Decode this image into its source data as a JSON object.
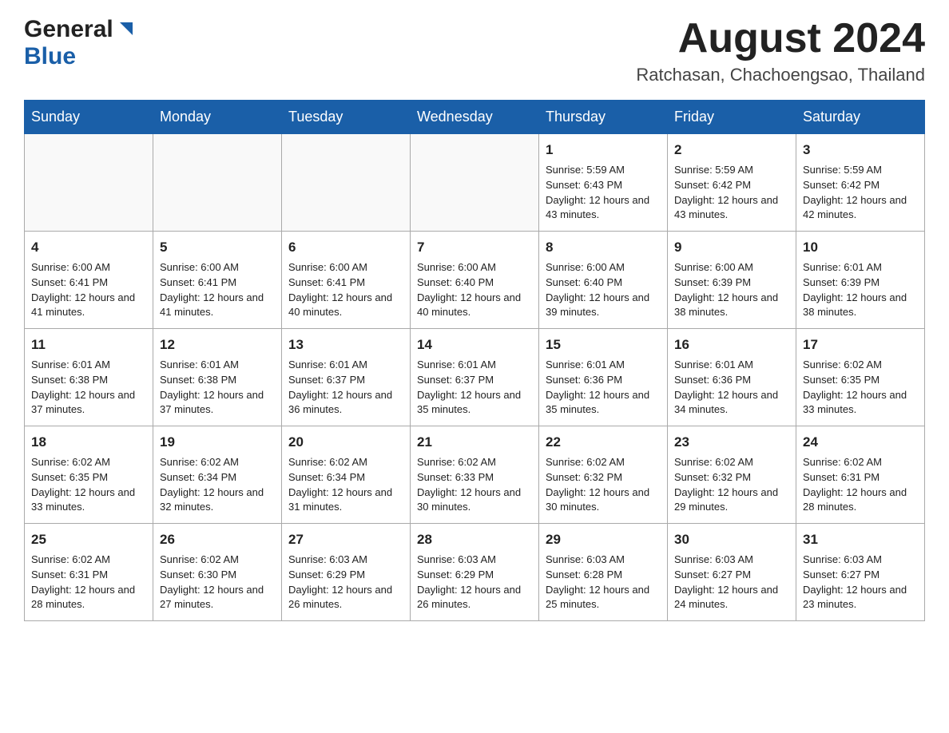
{
  "header": {
    "logo_general": "General",
    "logo_blue": "Blue",
    "month_title": "August 2024",
    "location": "Ratchasan, Chachoengsao, Thailand"
  },
  "weekdays": [
    "Sunday",
    "Monday",
    "Tuesday",
    "Wednesday",
    "Thursday",
    "Friday",
    "Saturday"
  ],
  "weeks": [
    [
      {
        "day": "",
        "sunrise": "",
        "sunset": "",
        "daylight": ""
      },
      {
        "day": "",
        "sunrise": "",
        "sunset": "",
        "daylight": ""
      },
      {
        "day": "",
        "sunrise": "",
        "sunset": "",
        "daylight": ""
      },
      {
        "day": "",
        "sunrise": "",
        "sunset": "",
        "daylight": ""
      },
      {
        "day": "1",
        "sunrise": "Sunrise: 5:59 AM",
        "sunset": "Sunset: 6:43 PM",
        "daylight": "Daylight: 12 hours and 43 minutes."
      },
      {
        "day": "2",
        "sunrise": "Sunrise: 5:59 AM",
        "sunset": "Sunset: 6:42 PM",
        "daylight": "Daylight: 12 hours and 43 minutes."
      },
      {
        "day": "3",
        "sunrise": "Sunrise: 5:59 AM",
        "sunset": "Sunset: 6:42 PM",
        "daylight": "Daylight: 12 hours and 42 minutes."
      }
    ],
    [
      {
        "day": "4",
        "sunrise": "Sunrise: 6:00 AM",
        "sunset": "Sunset: 6:41 PM",
        "daylight": "Daylight: 12 hours and 41 minutes."
      },
      {
        "day": "5",
        "sunrise": "Sunrise: 6:00 AM",
        "sunset": "Sunset: 6:41 PM",
        "daylight": "Daylight: 12 hours and 41 minutes."
      },
      {
        "day": "6",
        "sunrise": "Sunrise: 6:00 AM",
        "sunset": "Sunset: 6:41 PM",
        "daylight": "Daylight: 12 hours and 40 minutes."
      },
      {
        "day": "7",
        "sunrise": "Sunrise: 6:00 AM",
        "sunset": "Sunset: 6:40 PM",
        "daylight": "Daylight: 12 hours and 40 minutes."
      },
      {
        "day": "8",
        "sunrise": "Sunrise: 6:00 AM",
        "sunset": "Sunset: 6:40 PM",
        "daylight": "Daylight: 12 hours and 39 minutes."
      },
      {
        "day": "9",
        "sunrise": "Sunrise: 6:00 AM",
        "sunset": "Sunset: 6:39 PM",
        "daylight": "Daylight: 12 hours and 38 minutes."
      },
      {
        "day": "10",
        "sunrise": "Sunrise: 6:01 AM",
        "sunset": "Sunset: 6:39 PM",
        "daylight": "Daylight: 12 hours and 38 minutes."
      }
    ],
    [
      {
        "day": "11",
        "sunrise": "Sunrise: 6:01 AM",
        "sunset": "Sunset: 6:38 PM",
        "daylight": "Daylight: 12 hours and 37 minutes."
      },
      {
        "day": "12",
        "sunrise": "Sunrise: 6:01 AM",
        "sunset": "Sunset: 6:38 PM",
        "daylight": "Daylight: 12 hours and 37 minutes."
      },
      {
        "day": "13",
        "sunrise": "Sunrise: 6:01 AM",
        "sunset": "Sunset: 6:37 PM",
        "daylight": "Daylight: 12 hours and 36 minutes."
      },
      {
        "day": "14",
        "sunrise": "Sunrise: 6:01 AM",
        "sunset": "Sunset: 6:37 PM",
        "daylight": "Daylight: 12 hours and 35 minutes."
      },
      {
        "day": "15",
        "sunrise": "Sunrise: 6:01 AM",
        "sunset": "Sunset: 6:36 PM",
        "daylight": "Daylight: 12 hours and 35 minutes."
      },
      {
        "day": "16",
        "sunrise": "Sunrise: 6:01 AM",
        "sunset": "Sunset: 6:36 PM",
        "daylight": "Daylight: 12 hours and 34 minutes."
      },
      {
        "day": "17",
        "sunrise": "Sunrise: 6:02 AM",
        "sunset": "Sunset: 6:35 PM",
        "daylight": "Daylight: 12 hours and 33 minutes."
      }
    ],
    [
      {
        "day": "18",
        "sunrise": "Sunrise: 6:02 AM",
        "sunset": "Sunset: 6:35 PM",
        "daylight": "Daylight: 12 hours and 33 minutes."
      },
      {
        "day": "19",
        "sunrise": "Sunrise: 6:02 AM",
        "sunset": "Sunset: 6:34 PM",
        "daylight": "Daylight: 12 hours and 32 minutes."
      },
      {
        "day": "20",
        "sunrise": "Sunrise: 6:02 AM",
        "sunset": "Sunset: 6:34 PM",
        "daylight": "Daylight: 12 hours and 31 minutes."
      },
      {
        "day": "21",
        "sunrise": "Sunrise: 6:02 AM",
        "sunset": "Sunset: 6:33 PM",
        "daylight": "Daylight: 12 hours and 30 minutes."
      },
      {
        "day": "22",
        "sunrise": "Sunrise: 6:02 AM",
        "sunset": "Sunset: 6:32 PM",
        "daylight": "Daylight: 12 hours and 30 minutes."
      },
      {
        "day": "23",
        "sunrise": "Sunrise: 6:02 AM",
        "sunset": "Sunset: 6:32 PM",
        "daylight": "Daylight: 12 hours and 29 minutes."
      },
      {
        "day": "24",
        "sunrise": "Sunrise: 6:02 AM",
        "sunset": "Sunset: 6:31 PM",
        "daylight": "Daylight: 12 hours and 28 minutes."
      }
    ],
    [
      {
        "day": "25",
        "sunrise": "Sunrise: 6:02 AM",
        "sunset": "Sunset: 6:31 PM",
        "daylight": "Daylight: 12 hours and 28 minutes."
      },
      {
        "day": "26",
        "sunrise": "Sunrise: 6:02 AM",
        "sunset": "Sunset: 6:30 PM",
        "daylight": "Daylight: 12 hours and 27 minutes."
      },
      {
        "day": "27",
        "sunrise": "Sunrise: 6:03 AM",
        "sunset": "Sunset: 6:29 PM",
        "daylight": "Daylight: 12 hours and 26 minutes."
      },
      {
        "day": "28",
        "sunrise": "Sunrise: 6:03 AM",
        "sunset": "Sunset: 6:29 PM",
        "daylight": "Daylight: 12 hours and 26 minutes."
      },
      {
        "day": "29",
        "sunrise": "Sunrise: 6:03 AM",
        "sunset": "Sunset: 6:28 PM",
        "daylight": "Daylight: 12 hours and 25 minutes."
      },
      {
        "day": "30",
        "sunrise": "Sunrise: 6:03 AM",
        "sunset": "Sunset: 6:27 PM",
        "daylight": "Daylight: 12 hours and 24 minutes."
      },
      {
        "day": "31",
        "sunrise": "Sunrise: 6:03 AM",
        "sunset": "Sunset: 6:27 PM",
        "daylight": "Daylight: 12 hours and 23 minutes."
      }
    ]
  ]
}
